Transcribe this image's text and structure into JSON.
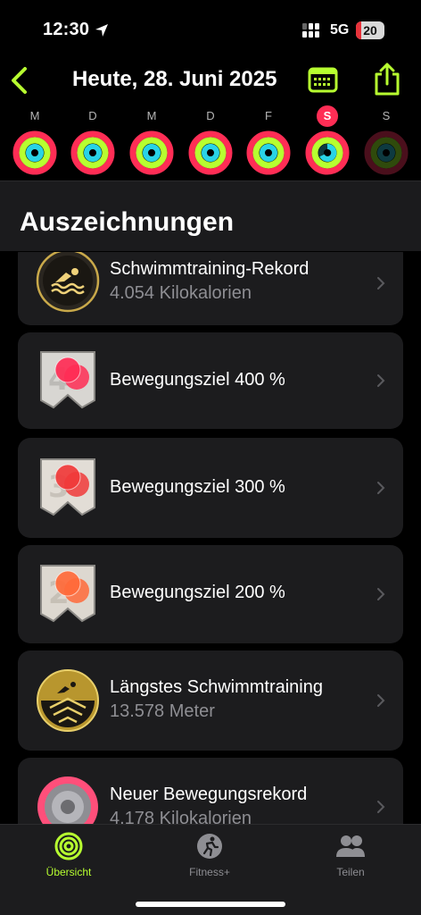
{
  "status": {
    "time": "12:30",
    "network": "5G",
    "battery": "20",
    "battery_level": 0.2,
    "battery_color": "#e8323a"
  },
  "header": {
    "title": "Heute, 28. Juni 2025",
    "accent": "#b7ff30"
  },
  "week": [
    {
      "letter": "M",
      "today": false
    },
    {
      "letter": "D",
      "today": false
    },
    {
      "letter": "M",
      "today": false
    },
    {
      "letter": "D",
      "today": false
    },
    {
      "letter": "F",
      "today": false
    },
    {
      "letter": "S",
      "today": true
    },
    {
      "letter": "S",
      "today": false
    }
  ],
  "section": {
    "title": "Auszeichnungen"
  },
  "awards": [
    {
      "title": "Schwimmtraining-Rekord",
      "subtitle": "4.054 Kilokalorien",
      "badge": "swim-record-badge-icon"
    },
    {
      "title": "Bewegungsziel 400 %",
      "subtitle": "",
      "badge": "move-goal-400-badge-icon"
    },
    {
      "title": "Bewegungsziel 300 %",
      "subtitle": "",
      "badge": "move-goal-300-badge-icon"
    },
    {
      "title": "Bewegungsziel 200 %",
      "subtitle": "",
      "badge": "move-goal-200-badge-icon"
    },
    {
      "title": "Längstes Schwimmtraining",
      "subtitle": "13.578 Meter",
      "badge": "longest-swim-badge-icon"
    },
    {
      "title": "Neuer Bewegungsrekord",
      "subtitle": "4.178 Kilokalorien",
      "badge": "new-move-record-badge-icon"
    }
  ],
  "tabs": [
    {
      "label": "Übersicht",
      "icon": "activity-rings-icon",
      "active": true
    },
    {
      "label": "Fitness+",
      "icon": "fitness-plus-icon",
      "active": false
    },
    {
      "label": "Teilen",
      "icon": "people-icon",
      "active": false
    }
  ],
  "colors": {
    "move": "#ff2d55",
    "exercise": "#b7ff30",
    "stand": "#29d3e6",
    "card": "#1c1c1e"
  }
}
